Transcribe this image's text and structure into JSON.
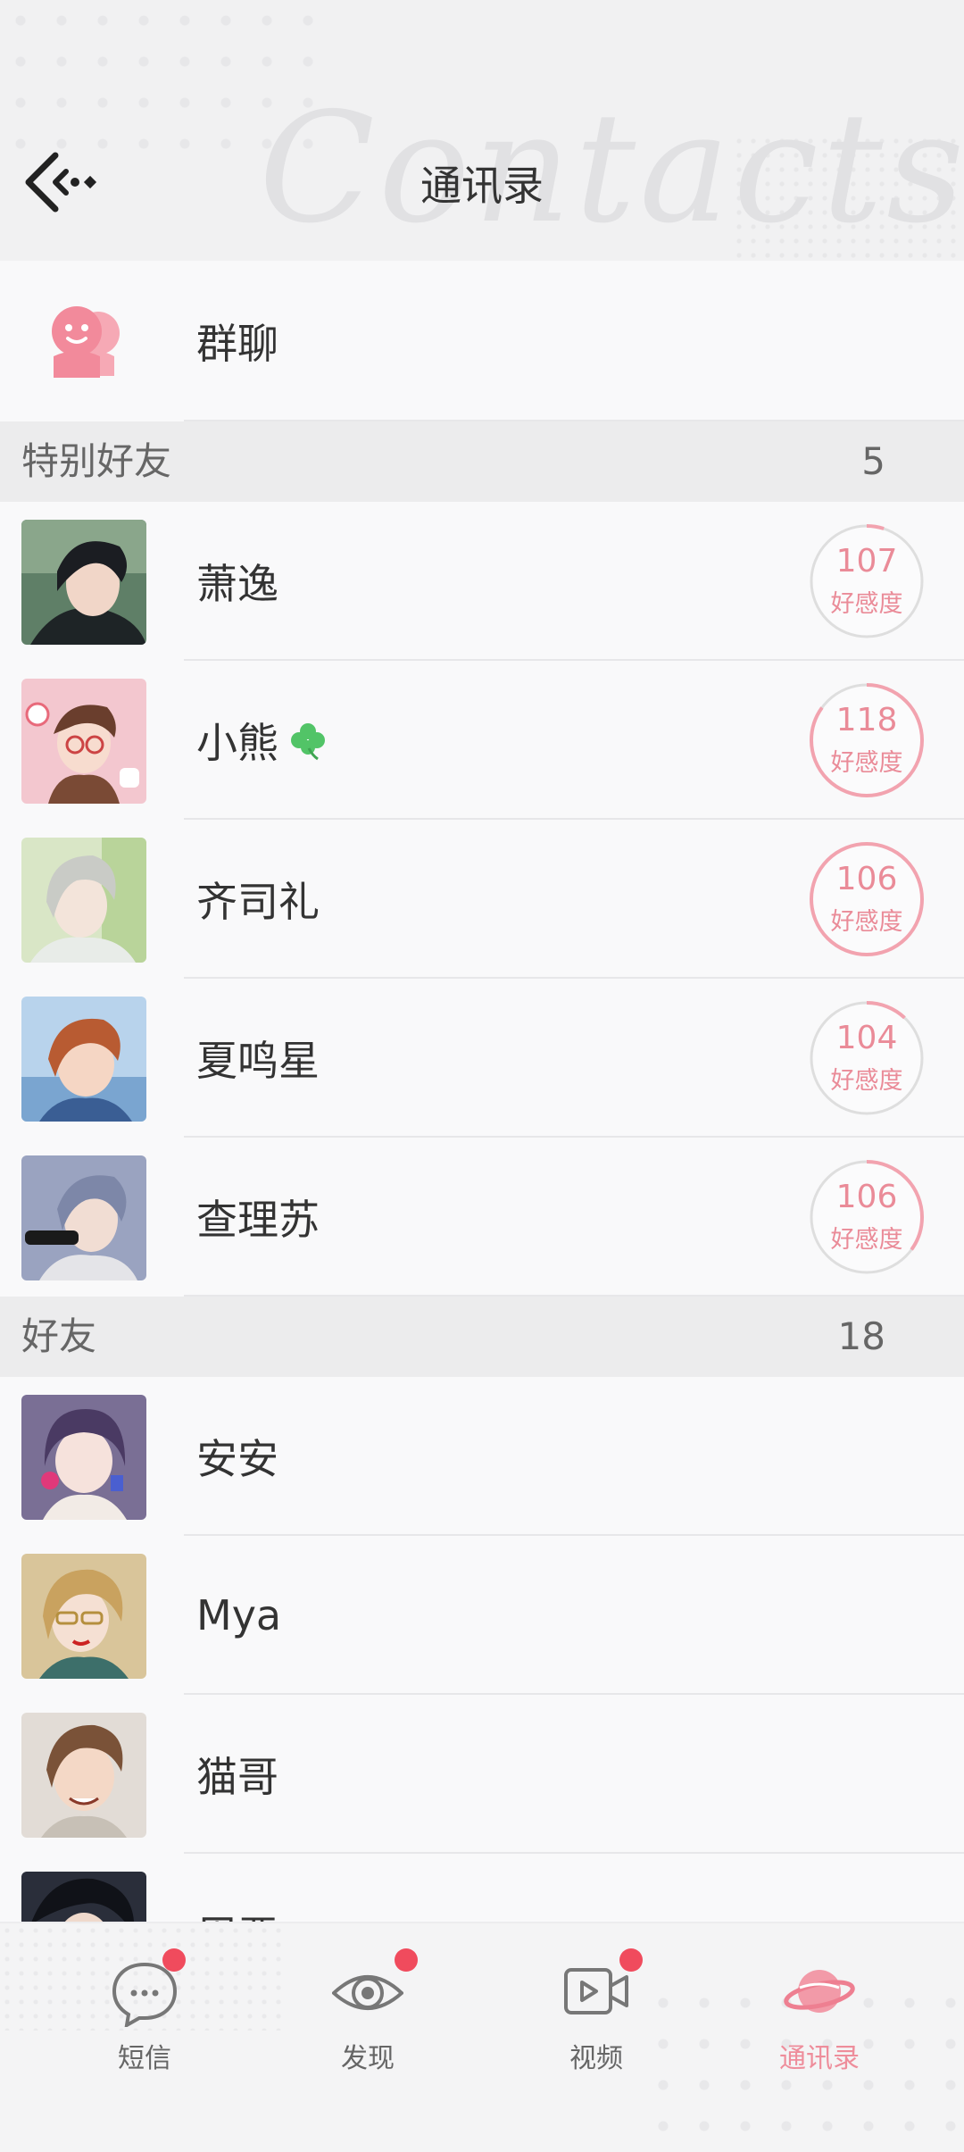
{
  "header": {
    "title": "通讯录",
    "watermark": "Contacts",
    "back_icon": "back-arrow-icon"
  },
  "group_chat": {
    "label": "群聊",
    "icon": "group-chat-icon",
    "icon_color": "#f28a9b"
  },
  "special_friends": {
    "label": "特别好友",
    "count": "5",
    "items": [
      {
        "name": "萧逸",
        "affinity_value": "107",
        "affinity_label": "好感度",
        "affinity_fraction": 0.05
      },
      {
        "name": "小熊",
        "affinity_value": "118",
        "affinity_label": "好感度",
        "affinity_fraction": 0.85,
        "badge": "clover-icon"
      },
      {
        "name": "齐司礼",
        "affinity_value": "106",
        "affinity_label": "好感度",
        "affinity_fraction": 1.0
      },
      {
        "name": "夏鸣星",
        "affinity_value": "104",
        "affinity_label": "好感度",
        "affinity_fraction": 0.12
      },
      {
        "name": "查理苏",
        "affinity_value": "106",
        "affinity_label": "好感度",
        "affinity_fraction": 0.35
      }
    ]
  },
  "friends": {
    "label": "好友",
    "count": "18",
    "items": [
      {
        "name": "安安"
      },
      {
        "name": "Mya"
      },
      {
        "name": "猫哥"
      },
      {
        "name": "周恶"
      }
    ]
  },
  "bottom_nav": {
    "items": [
      {
        "label": "短信",
        "icon": "chat-bubble-icon",
        "badge": true,
        "active": false
      },
      {
        "label": "发现",
        "icon": "eye-icon",
        "badge": true,
        "active": false
      },
      {
        "label": "视频",
        "icon": "video-icon",
        "badge": true,
        "active": false
      },
      {
        "label": "通讯录",
        "icon": "planet-icon",
        "badge": false,
        "active": true
      }
    ]
  },
  "colors": {
    "accent": "#ee8d9b",
    "badge": "#f04b5d",
    "section_bg": "#ececed"
  }
}
